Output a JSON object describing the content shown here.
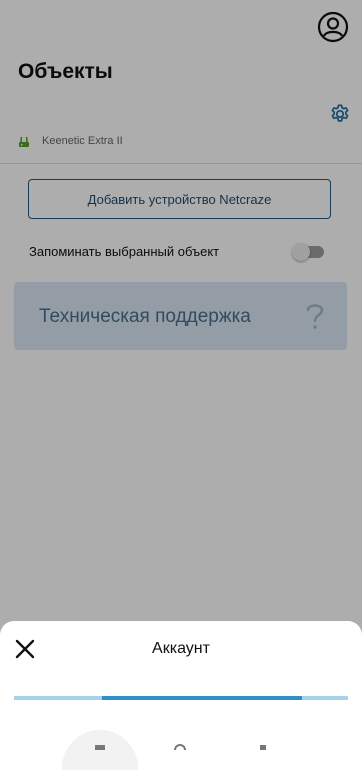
{
  "page": {
    "title": "Объекты",
    "object_name_tick": "ʻʼ",
    "router_model": "Keenetic Extra II",
    "add_device_button": "Добавить устройство Netcraze",
    "remember_object_label": "Запоминать выбранный объект",
    "remember_object_enabled": false,
    "support_label": "Техническая поддержка"
  },
  "bottom_sheet": {
    "title": "Аккаунт"
  },
  "colors": {
    "accent": "#1f5a80",
    "support_card": "#dbe8f3",
    "progress_track": "#a8d2ea",
    "progress_fill": "#2f8fc6",
    "overlay": "rgba(0,0,0,0.32)"
  },
  "icons": {
    "account": "account-circle-icon",
    "settings": "gear-icon",
    "router": "router-icon",
    "help": "question-mark-icon",
    "close": "close-icon"
  }
}
